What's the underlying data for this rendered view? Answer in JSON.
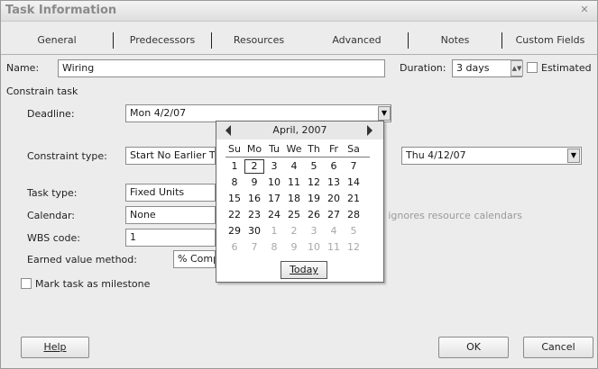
{
  "window": {
    "title": "Task Information",
    "close_glyph": "✕"
  },
  "tabs": [
    {
      "label": "General"
    },
    {
      "label": "Predecessors"
    },
    {
      "label": "Resources"
    },
    {
      "label": "Advanced"
    },
    {
      "label": "Notes"
    },
    {
      "label": "Custom Fields"
    }
  ],
  "form": {
    "name_label": "Name:",
    "name_value": "Wiring",
    "duration_label": "Duration:",
    "duration_value": "3 days",
    "estimated_label": "Estimated",
    "constrain_heading": "Constrain task",
    "deadline_label": "Deadline:",
    "deadline_value": "Mon 4/2/07",
    "constraint_type_label": "Constraint type:",
    "constraint_type_value": "Start No Earlier Than",
    "constraint_date_value": "Thu 4/12/07",
    "task_type_label": "Task type:",
    "task_type_value": "Fixed Units",
    "calendar_label": "Calendar:",
    "calendar_value": "None",
    "scheduling_ignores_label": "Scheduling ignores resource calendars",
    "wbs_label": "WBS code:",
    "wbs_value": "1",
    "earned_value_label": "Earned value method:",
    "earned_value_value": "% Complete",
    "milestone_label": "Mark task as milestone"
  },
  "calendar": {
    "month_label": "April, 2007",
    "weekdays": [
      "Su",
      "Mo",
      "Tu",
      "We",
      "Th",
      "Fr",
      "Sa"
    ],
    "weeks": [
      [
        {
          "d": "1"
        },
        {
          "d": "2",
          "sel": true
        },
        {
          "d": "3"
        },
        {
          "d": "4"
        },
        {
          "d": "5"
        },
        {
          "d": "6"
        },
        {
          "d": "7"
        }
      ],
      [
        {
          "d": "8"
        },
        {
          "d": "9"
        },
        {
          "d": "10"
        },
        {
          "d": "11"
        },
        {
          "d": "12"
        },
        {
          "d": "13"
        },
        {
          "d": "14"
        }
      ],
      [
        {
          "d": "15"
        },
        {
          "d": "16"
        },
        {
          "d": "17"
        },
        {
          "d": "18"
        },
        {
          "d": "19"
        },
        {
          "d": "20"
        },
        {
          "d": "21"
        }
      ],
      [
        {
          "d": "22"
        },
        {
          "d": "23"
        },
        {
          "d": "24"
        },
        {
          "d": "25"
        },
        {
          "d": "26"
        },
        {
          "d": "27"
        },
        {
          "d": "28"
        }
      ],
      [
        {
          "d": "29"
        },
        {
          "d": "30"
        },
        {
          "d": "1",
          "dim": true
        },
        {
          "d": "2",
          "dim": true
        },
        {
          "d": "3",
          "dim": true
        },
        {
          "d": "4",
          "dim": true
        },
        {
          "d": "5",
          "dim": true
        }
      ],
      [
        {
          "d": "6",
          "dim": true
        },
        {
          "d": "7",
          "dim": true
        },
        {
          "d": "8",
          "dim": true
        },
        {
          "d": "9",
          "dim": true
        },
        {
          "d": "10",
          "dim": true
        },
        {
          "d": "11",
          "dim": true
        },
        {
          "d": "12",
          "dim": true
        }
      ]
    ],
    "today_label": "Today"
  },
  "buttons": {
    "help": "Help",
    "ok": "OK",
    "cancel": "Cancel"
  }
}
